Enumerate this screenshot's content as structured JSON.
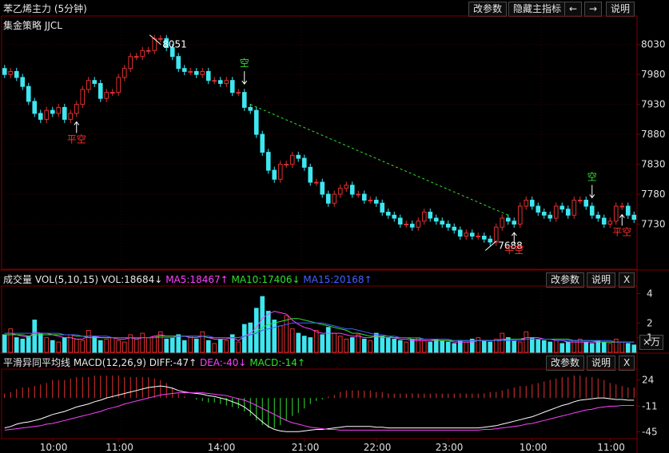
{
  "title": "苯乙烯主力 (5分钟)",
  "toolbar": {
    "adjust": "改参数",
    "hide": "隐藏主指标",
    "prev": "←",
    "next": "→",
    "help": "说明"
  },
  "strategy": "集金策略 JJCL",
  "colors": {
    "bg": "#000000",
    "up": "#e03030",
    "down": "#3ee6f0",
    "grid": "#3a0000",
    "axis": "#7a0000",
    "ma5": "#ff40ff",
    "ma10": "#30e030",
    "ma15": "#4060ff",
    "dif": "#ffffff",
    "dea": "#ff40ff"
  },
  "price_panel": {
    "y_ticks": [
      "8030",
      "7980",
      "7930",
      "7880",
      "7830",
      "7780",
      "7730"
    ],
    "high_label": "8051",
    "low_label": "7688",
    "signals": [
      {
        "bar": 12,
        "text": "平空",
        "dir": "up"
      },
      {
        "bar": 40,
        "text": "空",
        "dir": "down"
      },
      {
        "bar": 85,
        "text": "平空",
        "dir": "up"
      },
      {
        "bar": 98,
        "text": "空",
        "dir": "down"
      },
      {
        "bar": 103,
        "text": "平空",
        "dir": "up"
      }
    ]
  },
  "volume_panel": {
    "label": "成交量 VOL(5,10,15)",
    "vol": "VOL:18684↓",
    "ma5": "MA5:18467↑",
    "ma10": "MA10:17406↓",
    "ma15": "MA15:20168↑",
    "buttons": {
      "adjust": "改参数",
      "help": "说明",
      "close": "X"
    },
    "y_ticks": [
      "4",
      "2",
      "1"
    ],
    "unit": "×万"
  },
  "macd_panel": {
    "label": "平滑异同平均线 MACD(12,26,9)",
    "diff": "DIFF:-47↑",
    "dea": "DEA:-40↓",
    "macd": "MACD:-14↑",
    "buttons": {
      "adjust": "改参数",
      "help": "说明",
      "close": "X"
    },
    "y_ticks": [
      "24",
      "-11",
      "-45"
    ]
  },
  "time_labels": [
    "10:00",
    "11:00",
    "14:00",
    "21:00",
    "22:00",
    "23:00",
    "10:00",
    "11:00"
  ],
  "chart_data": {
    "type": "candlestick",
    "ylim": [
      7688,
      8051
    ],
    "o": [
      7990,
      7980,
      7985,
      7975,
      7960,
      7935,
      7915,
      7905,
      7920,
      7915,
      7925,
      7905,
      7915,
      7930,
      7955,
      7970,
      7965,
      7940,
      7950,
      7950,
      7975,
      7990,
      8010,
      8010,
      8020,
      8020,
      8040,
      8040,
      8025,
      8010,
      7990,
      7985,
      7985,
      7980,
      7985,
      7970,
      7970,
      7965,
      7970,
      7950,
      7950,
      7925,
      7920,
      7880,
      7850,
      7820,
      7805,
      7830,
      7830,
      7845,
      7840,
      7825,
      7800,
      7800,
      7780,
      7765,
      7780,
      7790,
      7795,
      7780,
      7780,
      7770,
      7770,
      7765,
      7750,
      7745,
      7740,
      7730,
      7730,
      7725,
      7735,
      7750,
      7740,
      7735,
      7730,
      7725,
      7720,
      7710,
      7715,
      7710,
      7710,
      7705,
      7700,
      7725,
      7740,
      7735,
      7730,
      7760,
      7770,
      7760,
      7750,
      7745,
      7740,
      7760,
      7755,
      7745,
      7770,
      7770,
      7760,
      7745,
      7740,
      7730,
      7735,
      7760,
      7760,
      7745
    ],
    "c": [
      7980,
      7985,
      7975,
      7960,
      7935,
      7915,
      7905,
      7920,
      7915,
      7925,
      7905,
      7915,
      7930,
      7955,
      7970,
      7965,
      7940,
      7950,
      7950,
      7975,
      7990,
      8010,
      8010,
      8020,
      8020,
      8040,
      8040,
      8025,
      8010,
      7990,
      7985,
      7985,
      7980,
      7985,
      7970,
      7970,
      7965,
      7970,
      7950,
      7950,
      7925,
      7920,
      7880,
      7850,
      7820,
      7805,
      7830,
      7830,
      7845,
      7840,
      7825,
      7800,
      7800,
      7780,
      7765,
      7780,
      7790,
      7795,
      7780,
      7780,
      7770,
      7770,
      7765,
      7750,
      7745,
      7740,
      7730,
      7730,
      7725,
      7735,
      7750,
      7740,
      7735,
      7730,
      7725,
      7720,
      7710,
      7715,
      7710,
      7710,
      7705,
      7700,
      7725,
      7740,
      7735,
      7730,
      7760,
      7770,
      7760,
      7750,
      7745,
      7740,
      7760,
      7755,
      7745,
      7770,
      7770,
      7760,
      7745,
      7740,
      7730,
      7735,
      7760,
      7760,
      7745,
      7738
    ],
    "vol": [
      1.2,
      1.6,
      1.0,
      0.9,
      1.1,
      2.2,
      1.3,
      1.0,
      0.8,
      0.7,
      1.0,
      1.2,
      0.9,
      0.8,
      1.5,
      1.1,
      0.8,
      0.9,
      1.0,
      0.8,
      0.7,
      1.2,
      0.9,
      1.3,
      1.0,
      1.1,
      1.4,
      0.9,
      1.0,
      1.2,
      0.8,
      1.1,
      0.9,
      1.4,
      0.8,
      0.6,
      0.9,
      0.8,
      1.2,
      0.7,
      1.9,
      2.0,
      3.0,
      3.8,
      2.8,
      2.2,
      1.8,
      2.5,
      1.6,
      1.3,
      1.1,
      1.0,
      1.5,
      1.2,
      1.7,
      1.3,
      1.1,
      0.9,
      1.0,
      1.2,
      0.9,
      0.8,
      1.3,
      1.1,
      1.0,
      0.9,
      0.8,
      0.7,
      0.9,
      1.0,
      0.8,
      0.7,
      0.9,
      0.8,
      0.7,
      0.6,
      0.8,
      0.7,
      0.9,
      1.0,
      0.8,
      0.7,
      0.9,
      1.3,
      1.0,
      0.8,
      0.7,
      1.4,
      1.0,
      0.9,
      0.8,
      0.7,
      0.8,
      0.6,
      0.7,
      0.8,
      0.9,
      0.7,
      0.6,
      0.8,
      0.7,
      0.6,
      0.9,
      0.7,
      0.6,
      0.5
    ],
    "ma5": [
      1.3,
      1.3,
      1.2,
      1.1,
      1.0,
      1.4,
      1.3,
      1.3,
      1.2,
      1.1,
      1.0,
      1.0,
      0.9,
      0.9,
      1.1,
      1.1,
      1.0,
      1.0,
      1.0,
      0.9,
      0.9,
      1.0,
      0.9,
      1.0,
      1.0,
      1.1,
      1.2,
      1.1,
      1.1,
      1.1,
      1.1,
      1.0,
      1.0,
      1.1,
      1.0,
      0.9,
      0.9,
      0.9,
      1.0,
      0.8,
      1.1,
      1.3,
      1.7,
      2.3,
      2.6,
      2.8,
      2.7,
      2.6,
      2.2,
      1.9,
      1.7,
      1.6,
      1.4,
      1.3,
      1.3,
      1.3,
      1.3,
      1.2,
      1.1,
      1.1,
      1.0,
      1.0,
      1.1,
      1.0,
      1.0,
      1.0,
      0.9,
      0.9,
      0.8,
      0.8,
      0.8,
      0.8,
      0.8,
      0.8,
      0.8,
      0.7,
      0.7,
      0.7,
      0.7,
      0.8,
      0.8,
      0.8,
      0.8,
      0.9,
      0.9,
      0.9,
      0.9,
      1.0,
      1.0,
      1.0,
      0.9,
      0.9,
      0.8,
      0.8,
      0.7,
      0.7,
      0.7,
      0.7,
      0.7,
      0.7,
      0.7,
      0.7,
      0.7,
      0.7,
      0.7,
      0.7
    ],
    "ma10": [
      1.2,
      1.2,
      1.2,
      1.2,
      1.1,
      1.2,
      1.2,
      1.2,
      1.2,
      1.2,
      1.2,
      1.2,
      1.1,
      1.1,
      1.0,
      1.0,
      1.0,
      1.0,
      1.0,
      1.0,
      1.0,
      1.0,
      1.0,
      1.0,
      1.0,
      1.0,
      1.1,
      1.1,
      1.1,
      1.1,
      1.1,
      1.1,
      1.1,
      1.1,
      1.0,
      1.0,
      1.0,
      1.0,
      1.0,
      1.0,
      1.1,
      1.2,
      1.4,
      1.7,
      1.9,
      2.0,
      2.1,
      2.2,
      2.3,
      2.3,
      2.2,
      2.1,
      2.0,
      1.9,
      1.8,
      1.7,
      1.6,
      1.5,
      1.3,
      1.3,
      1.2,
      1.1,
      1.1,
      1.1,
      1.1,
      1.0,
      1.0,
      1.0,
      0.9,
      0.9,
      0.9,
      0.9,
      0.8,
      0.8,
      0.8,
      0.8,
      0.8,
      0.8,
      0.8,
      0.8,
      0.8,
      0.8,
      0.8,
      0.8,
      0.9,
      0.9,
      0.9,
      0.9,
      0.9,
      0.9,
      0.9,
      0.9,
      0.9,
      0.9,
      0.9,
      0.8,
      0.8,
      0.8,
      0.8,
      0.7,
      0.7,
      0.7,
      0.7,
      0.7,
      0.7,
      0.7
    ],
    "ma15": [
      1.3,
      1.3,
      1.3,
      1.3,
      1.3,
      1.3,
      1.3,
      1.3,
      1.3,
      1.3,
      1.2,
      1.2,
      1.2,
      1.1,
      1.1,
      1.1,
      1.1,
      1.1,
      1.0,
      1.0,
      1.0,
      1.0,
      1.0,
      1.0,
      1.0,
      1.0,
      1.0,
      1.0,
      1.0,
      1.1,
      1.1,
      1.1,
      1.1,
      1.1,
      1.1,
      1.0,
      1.0,
      1.0,
      1.0,
      1.0,
      1.1,
      1.2,
      1.3,
      1.5,
      1.6,
      1.7,
      1.8,
      1.9,
      2.0,
      2.0,
      2.0,
      2.0,
      2.0,
      2.0,
      1.9,
      1.8,
      1.7,
      1.6,
      1.6,
      1.5,
      1.4,
      1.3,
      1.2,
      1.2,
      1.1,
      1.1,
      1.0,
      1.0,
      1.0,
      1.0,
      0.9,
      0.9,
      0.9,
      0.9,
      0.9,
      0.8,
      0.8,
      0.8,
      0.8,
      0.8,
      0.8,
      0.8,
      0.8,
      0.8,
      0.8,
      0.8,
      0.8,
      0.9,
      0.9,
      0.9,
      0.9,
      0.9,
      0.8,
      0.8,
      0.8,
      0.8,
      0.8,
      0.8,
      0.8,
      0.8,
      0.8,
      0.8,
      0.7,
      0.7,
      0.7,
      0.7
    ],
    "dif": [
      -40,
      -38,
      -35,
      -33,
      -32,
      -30,
      -28,
      -25,
      -22,
      -20,
      -18,
      -15,
      -12,
      -10,
      -8,
      -5,
      -3,
      0,
      2,
      4,
      6,
      8,
      10,
      12,
      14,
      15,
      16,
      15,
      13,
      10,
      8,
      7,
      6,
      5,
      3,
      2,
      0,
      -2,
      -5,
      -8,
      -12,
      -18,
      -25,
      -32,
      -38,
      -42,
      -44,
      -45,
      -45,
      -45,
      -44,
      -43,
      -42,
      -42,
      -41,
      -40,
      -39,
      -38,
      -38,
      -38,
      -38,
      -38,
      -39,
      -39,
      -40,
      -40,
      -40,
      -40,
      -40,
      -40,
      -40,
      -40,
      -40,
      -40,
      -40,
      -40,
      -40,
      -40,
      -40,
      -40,
      -39,
      -38,
      -37,
      -35,
      -33,
      -31,
      -29,
      -27,
      -25,
      -22,
      -19,
      -16,
      -13,
      -10,
      -8,
      -5,
      -3,
      -2,
      -1,
      0,
      0,
      -1,
      -2,
      -2,
      -3,
      -3
    ],
    "dea": [
      -43,
      -42,
      -41,
      -40,
      -39,
      -38,
      -37,
      -35,
      -34,
      -32,
      -30,
      -28,
      -26,
      -24,
      -22,
      -20,
      -18,
      -15,
      -13,
      -11,
      -8,
      -6,
      -4,
      -2,
      0,
      2,
      4,
      5,
      6,
      7,
      7,
      7,
      7,
      7,
      6,
      5,
      4,
      3,
      1,
      -1,
      -3,
      -6,
      -10,
      -14,
      -18,
      -22,
      -26,
      -30,
      -33,
      -35,
      -37,
      -39,
      -40,
      -41,
      -42,
      -42,
      -43,
      -43,
      -43,
      -43,
      -43,
      -43,
      -43,
      -43,
      -43,
      -43,
      -43,
      -43,
      -43,
      -43,
      -43,
      -43,
      -43,
      -43,
      -43,
      -43,
      -43,
      -43,
      -43,
      -43,
      -42,
      -42,
      -41,
      -40,
      -39,
      -38,
      -37,
      -35,
      -34,
      -32,
      -30,
      -28,
      -26,
      -24,
      -22,
      -20,
      -18,
      -16,
      -15,
      -13,
      -12,
      -11,
      -11,
      -10,
      -10,
      -10
    ],
    "macd": [
      6,
      8,
      12,
      14,
      14,
      16,
      18,
      20,
      24,
      24,
      24,
      26,
      28,
      28,
      28,
      30,
      30,
      30,
      30,
      30,
      28,
      28,
      28,
      28,
      28,
      26,
      24,
      20,
      14,
      6,
      2,
      0,
      -2,
      -4,
      -6,
      -6,
      -8,
      -10,
      -12,
      -14,
      -18,
      -24,
      -30,
      -36,
      -40,
      -40,
      -36,
      -30,
      -24,
      -20,
      -14,
      -8,
      -4,
      -2,
      2,
      4,
      8,
      10,
      10,
      10,
      10,
      10,
      8,
      8,
      6,
      6,
      6,
      6,
      6,
      6,
      6,
      6,
      6,
      6,
      6,
      6,
      6,
      6,
      6,
      6,
      6,
      8,
      8,
      10,
      12,
      14,
      16,
      16,
      18,
      20,
      22,
      24,
      26,
      28,
      28,
      30,
      30,
      28,
      28,
      26,
      24,
      20,
      18,
      16,
      14,
      14
    ]
  }
}
